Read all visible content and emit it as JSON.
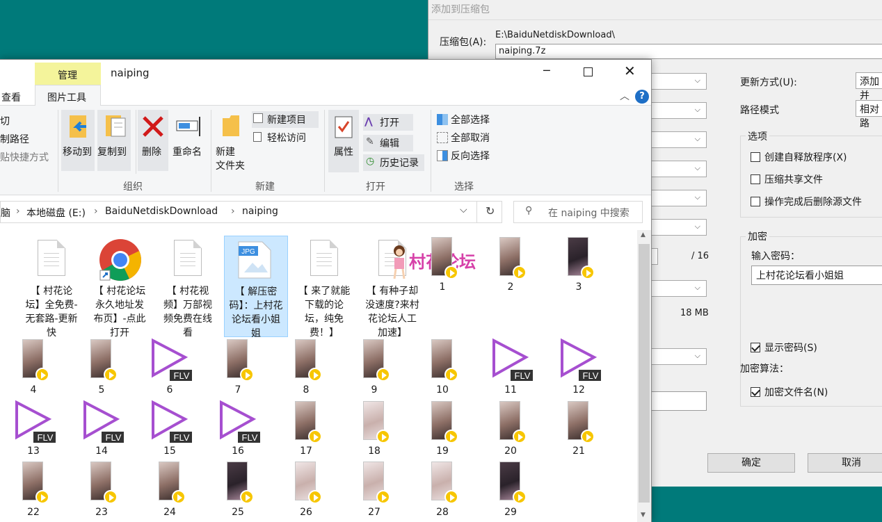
{
  "archive_dialog": {
    "title": "添加到压缩包",
    "archive_label": "压缩包(A):",
    "archive_dir": "E:\\BaiduNetdiskDownload\\",
    "archive_name": "naiping.7z",
    "update_mode_label": "更新方式(U):",
    "update_mode_value": "添加并",
    "path_mode_label": "路径模式",
    "path_mode_value": "相对路",
    "threads_suffix": "/ 16",
    "memory_text": "18 MB",
    "options_group": "选项",
    "options": [
      {
        "label": "创建自释放程序(X)",
        "checked": false
      },
      {
        "label": "压缩共享文件",
        "checked": false
      },
      {
        "label": "操作完成后删除源文件",
        "checked": false
      }
    ],
    "encryption_group": "加密",
    "password_label": "输入密码：",
    "password_value": "上村花论坛看小姐姐",
    "show_password": {
      "label": "显示密码(S)",
      "checked": true
    },
    "encrypt_method_label": "加密算法：",
    "encrypt_names": {
      "label": "加密文件名(N)",
      "checked": true
    },
    "ok_label": "确定",
    "cancel_label": "取消"
  },
  "explorer": {
    "title": "naiping",
    "context_tab": "管理",
    "tab_view": "查看",
    "tab_picture_tools": "图片工具",
    "clip_items": [
      "切",
      "制路径",
      "贴快捷方式"
    ],
    "organize": {
      "move_to": "移动到",
      "copy_to": "复制到",
      "delete": "删除",
      "rename": "重命名",
      "group": "组织"
    },
    "new": {
      "new_folder_1": "新建",
      "new_folder_2": "文件夹",
      "new_item": "新建项目",
      "easy_access": "轻松访问",
      "group": "新建"
    },
    "open": {
      "properties": "属性",
      "open": "打开",
      "edit": "编辑",
      "history": "历史记录",
      "group": "打开"
    },
    "select": {
      "select_all": "全部选择",
      "select_none": "全部取消",
      "invert": "反向选择",
      "group": "选择"
    },
    "breadcrumb": [
      "脑",
      "本地磁盘 (E:)",
      "BaiduNetdiskDownload",
      "naiping"
    ],
    "search_placeholder": "在 naiping 中搜索",
    "watermark": "村花论坛",
    "files": [
      {
        "name": "【 村花论坛】全免费-无套路-更新快",
        "icon": "text-file"
      },
      {
        "name": "【 村花论坛永久地址发布页】-点此打开",
        "icon": "chrome-shortcut"
      },
      {
        "name": "【 村花视频】万部视频免费在线看",
        "icon": "text-file"
      },
      {
        "name": "【 解压密码】：上村花论坛看小姐姐",
        "icon": "jpg-file"
      },
      {
        "name": "【 来了就能下载的论坛，纯免费！】",
        "icon": "text-file"
      },
      {
        "name": "【 有种子却没速度?来村花论坛人工加速】",
        "icon": "text-file"
      }
    ],
    "videos": [
      "1",
      "2",
      "3",
      "4",
      "5",
      "6",
      "7",
      "8",
      "9",
      "10",
      "11",
      "12",
      "13",
      "14",
      "15",
      "16",
      "17",
      "18",
      "19",
      "20",
      "21",
      "22",
      "23",
      "24",
      "25",
      "26",
      "27",
      "28",
      "29"
    ],
    "flv_label": "FLV",
    "flv_items": [
      "6",
      "11",
      "12",
      "13",
      "14",
      "15",
      "16"
    ]
  }
}
